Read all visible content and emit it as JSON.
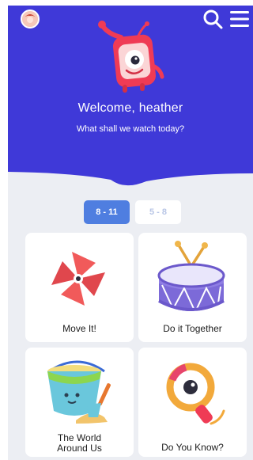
{
  "hero": {
    "welcome": "Welcome, heather",
    "subtitle": "What shall we watch today?"
  },
  "age_tabs": [
    {
      "label": "8 - 11",
      "selected": true
    },
    {
      "label": "5 - 8",
      "selected": false
    }
  ],
  "categories": [
    {
      "label": "Move It!",
      "icon": "pinwheel-icon"
    },
    {
      "label": "Do it Together",
      "icon": "drum-icon"
    },
    {
      "label": "The World Around Us",
      "icon": "sand-bucket-icon"
    },
    {
      "label": "Do You Know?",
      "icon": "magnifying-glass-icon"
    }
  ],
  "colors": {
    "hero_bg": "#3f39d8",
    "screen_bg": "#eceef3",
    "active_tab": "#4f7ee0",
    "inactive_tab_text": "#b9c6e6",
    "mascot_red": "#ef3b55"
  }
}
